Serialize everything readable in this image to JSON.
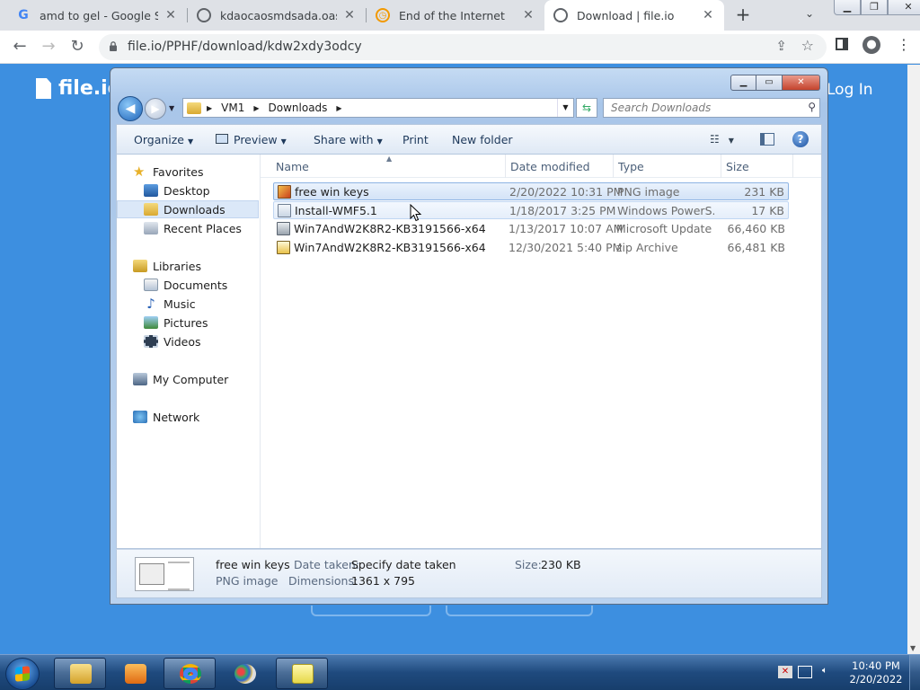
{
  "browser": {
    "tabs": [
      {
        "title": "amd to gel - Google Search",
        "favicon": "G",
        "favicon_color": "#4285f4"
      },
      {
        "title": "kdaocaosmdsada.oasmdaa",
        "favicon": "globe-icon",
        "favicon_color": "#5f6368"
      },
      {
        "title": "End of the Internet",
        "favicon": "clock-icon",
        "favicon_color": "#f29900"
      },
      {
        "title": "Download | file.io",
        "favicon": "globe-icon",
        "favicon_color": "#5f6368",
        "active": true
      }
    ],
    "new_tab": "+",
    "url": "file.io/PPHF/download/kdw2xdy3odcy"
  },
  "page": {
    "logo": "file.io",
    "login": "Log In"
  },
  "explorer": {
    "path": [
      "VM1",
      "Downloads"
    ],
    "search_placeholder": "Search Downloads",
    "commands": {
      "organize": "Organize",
      "preview": "Preview",
      "share": "Share with",
      "print": "Print",
      "new_folder": "New folder"
    },
    "nav": {
      "favorites": "Favorites",
      "desktop": "Desktop",
      "downloads": "Downloads",
      "recent": "Recent Places",
      "libraries": "Libraries",
      "documents": "Documents",
      "music": "Music",
      "pictures": "Pictures",
      "videos": "Videos",
      "computer": "My Computer",
      "network": "Network"
    },
    "columns": {
      "name": "Name",
      "date": "Date modified",
      "type": "Type",
      "size": "Size"
    },
    "files": [
      {
        "name": "free win keys",
        "date": "2/20/2022 10:31 PM",
        "type": "PNG image",
        "size": "231 KB"
      },
      {
        "name": "Install-WMF5.1",
        "date": "1/18/2017 3:25 PM",
        "type": "Windows PowerS...",
        "size": "17 KB"
      },
      {
        "name": "Win7AndW2K8R2-KB3191566-x64",
        "date": "1/13/2017 10:07 AM",
        "type": "Microsoft Update ...",
        "size": "66,460 KB"
      },
      {
        "name": "Win7AndW2K8R2-KB3191566-x64",
        "date": "12/30/2021 5:40 PM",
        "type": "zip Archive",
        "size": "66,481 KB"
      }
    ],
    "details": {
      "name": "free win keys",
      "type": "PNG image",
      "date_label": "Date taken:",
      "date_value": "Specify date taken",
      "dim_label": "Dimensions:",
      "dim_value": "1361 x 795",
      "size_label": "Size:",
      "size_value": "230 KB"
    }
  },
  "taskbar": {
    "time": "10:40 PM",
    "date": "2/20/2022"
  },
  "colors": {
    "page_bg": "#3d8fe0",
    "selection": "#d3e3f7"
  }
}
